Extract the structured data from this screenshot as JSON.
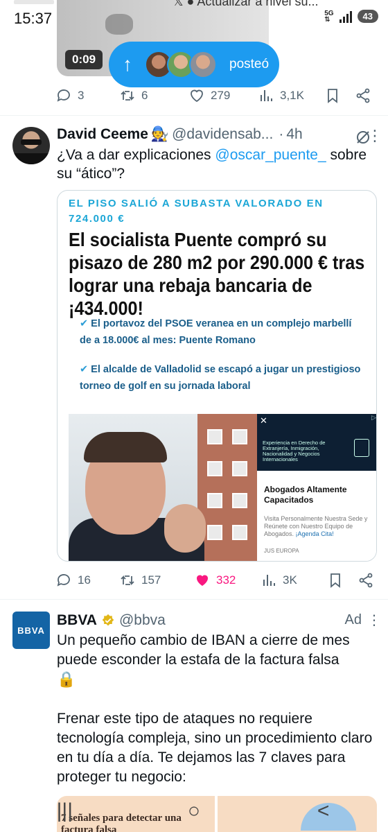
{
  "status_bar": {
    "time": "15:37",
    "notification_text": "Actualizar a nivel su...",
    "network": "5G",
    "battery": "43"
  },
  "top_tweet": {
    "video_duration": "0:09",
    "new_posts_label": "posteó",
    "stats": {
      "replies": "3",
      "reposts": "6",
      "likes": "279",
      "views": "3,1K"
    }
  },
  "tweet_ceeme": {
    "author_name": "David Ceeme",
    "author_emoji": "🧑‍🔧",
    "handle": "@davidensab...",
    "time": "4h",
    "text_before": "¿Va a dar explicaciones ",
    "mention": "@oscar_puente_",
    "text_after": " sobre su “ático”?",
    "card": {
      "kicker": "EL PISO SALIÓ A SUBASTA VALORADO EN 724.000 €",
      "headline": "El socialista Puente compró su pisazo de 280 m2 por 290.000 € tras lograr una rebaja bancaria de ¡434.000!",
      "bullet_1": "El portavoz del PSOE veranea en un complejo marbellí de a 18.000€ al mes: Puente Romano",
      "bullet_2": "El alcalde de Valladolid se escapó a jugar un prestigioso torneo de golf en su jornada laboral",
      "ad": {
        "banner_text": "Experiencia en Derecho de Extranjería, Inmigración, Nacionalidad y Negocios Internacionales",
        "title": "Abogados Altamente Capacitados",
        "desc_plain": "Visita Personalmente Nuestra Sede y Reúnete con Nuestro Equipo de Abogados. ",
        "desc_link": "¡Agenda Cita!",
        "source": "JUS EUROPA"
      }
    },
    "stats": {
      "replies": "16",
      "reposts": "157",
      "likes": "332",
      "views": "3K"
    }
  },
  "tweet_bbva": {
    "logo_text": "BBVA",
    "author_name": "BBVA",
    "handle": "@bbva",
    "ad_label": "Ad",
    "paragraph_1": "Un pequeño cambio de IBAN a cierre de mes puede esconder la estafa de la factura falsa",
    "emoji": "🔒",
    "paragraph_2": "Frenar este tipo de ataques no requiere tecnología compleja, sino un procedimiento claro en tu día a día. Te dejamos las 7 claves para proteger tu negocio:",
    "promo_text": "7 señales para detectar una factura falsa"
  },
  "colors": {
    "accent": "#1d9bf0",
    "like": "#f91880",
    "muted": "#536471",
    "bbva": "#1464a5"
  },
  "nav": {
    "recents": "|||",
    "home": "○",
    "back": "<"
  }
}
